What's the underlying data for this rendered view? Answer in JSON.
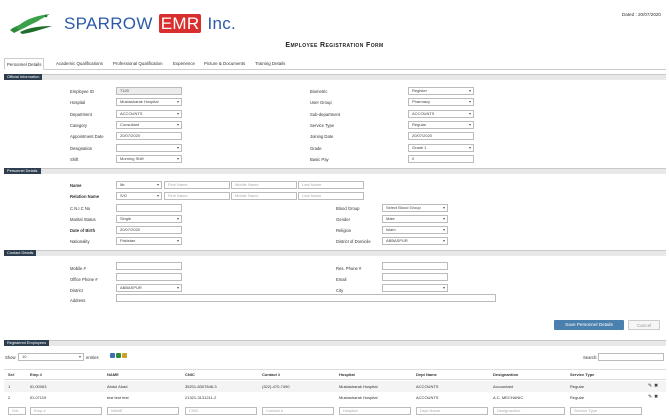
{
  "header": {
    "logo_text_pre": "SPARROW",
    "logo_text_emr": "EMR",
    "logo_text_post": "Inc.",
    "dated": "Dated : 20/07/2020",
    "form_title": "Employee Registration Form"
  },
  "tabs": [
    {
      "label": "Personnel Details"
    },
    {
      "label": "Academic Qualifications"
    },
    {
      "label": "Professional Qualification"
    },
    {
      "label": "Experience"
    },
    {
      "label": "Picture & Documents"
    },
    {
      "label": "Training Details"
    }
  ],
  "official": {
    "section_label": "Official Information",
    "employee_id": {
      "label": "Employee ID",
      "value": "7120"
    },
    "biometric": {
      "label": "Biometric",
      "value": "Register"
    },
    "hospital": {
      "label": "Hospital",
      "value": "Mustasharak Hospital"
    },
    "user_group": {
      "label": "User Group",
      "value": "Pharmacy"
    },
    "department": {
      "label": "Department",
      "value": "ACCOUNTS"
    },
    "sub_department": {
      "label": "Sub-department",
      "value": "ACCOUNTS"
    },
    "category": {
      "label": "Category",
      "value": "Consultant"
    },
    "service_type": {
      "label": "Service Type",
      "value": "Regular"
    },
    "appointment_date": {
      "label": "Appointment Date",
      "value": "20/07/2020"
    },
    "joining_date": {
      "label": "Joining Date",
      "value": "20/07/2020"
    },
    "designation": {
      "label": "Designation",
      "value": ""
    },
    "grade": {
      "label": "Grade",
      "value": "Grade 1"
    },
    "shift": {
      "label": "Shift",
      "value": "Morning Shift"
    },
    "basic_pay": {
      "label": "Basic Pay",
      "value": "0"
    }
  },
  "personnel": {
    "section_label": "Personnel Details",
    "name": {
      "label": "Name",
      "title": "Mr.",
      "first_ph": "First Name",
      "middle_ph": "Middle Name",
      "last_ph": "Last Name"
    },
    "relation": {
      "label": "Relation Name",
      "title": "S/O",
      "first_ph": "First Name",
      "middle_ph": "Middle Name",
      "last_ph": "Last Name"
    },
    "cnic": {
      "label": "C.N.I.C No",
      "value": ""
    },
    "blood_group": {
      "label": "Blood Group",
      "value": "Select Blood Group"
    },
    "marital_status": {
      "label": "Marital Status",
      "value": "Single"
    },
    "gender": {
      "label": "Gender",
      "value": "Male"
    },
    "dob": {
      "label": "Date of Birth",
      "value": "20/07/2020"
    },
    "religion": {
      "label": "Religion",
      "value": "Islam"
    },
    "nationality": {
      "label": "Nationality",
      "value": "Pakistan"
    },
    "domicile": {
      "label": "District of Domicile",
      "value": "ABBASPUR"
    }
  },
  "contact": {
    "section_label": "Contact Details",
    "mobile": {
      "label": "Mobile #",
      "value": ""
    },
    "res_phone": {
      "label": "Res. Phone #",
      "value": ""
    },
    "office_phone": {
      "label": "Office Phone #",
      "value": ""
    },
    "email": {
      "label": "Email",
      "value": ""
    },
    "district": {
      "label": "District",
      "value": "ABBASPUR"
    },
    "city": {
      "label": "City",
      "value": ""
    },
    "address": {
      "label": "Address",
      "value": ""
    }
  },
  "actions": {
    "save_label": "Save Personnel Details",
    "cancel_label": "Cancel"
  },
  "registered": {
    "section_label": "Registered Employees",
    "show_label": "Show",
    "show_value": "10",
    "entries_label": "entries",
    "search_label": "Search:",
    "columns": [
      "Sr#",
      "Emp #",
      "NAME",
      "CNIC",
      "Contact #",
      "Hospital",
      "Dept Name",
      "Designantion",
      "Service Type"
    ],
    "rows": [
      [
        "1",
        "ID-00063",
        "Abdul Ahad",
        "35201-8307848-3",
        "(322)-470-7490",
        "Mustasharak Hospital",
        "ACCOUNTS",
        "Accountant",
        "Regular"
      ],
      [
        "2",
        "ID-07119",
        "test test test",
        "21321-3131211-2",
        "",
        "Mustasharak Hospital",
        "ACCOUNTS",
        "A.C. MECHANIC",
        "Regular"
      ]
    ],
    "filters": [
      "Sr#",
      "Emp #",
      "NAME",
      "CNIC",
      "Contact #",
      "Hospital",
      "Dept Name",
      "Designantion",
      "Service Type"
    ]
  }
}
